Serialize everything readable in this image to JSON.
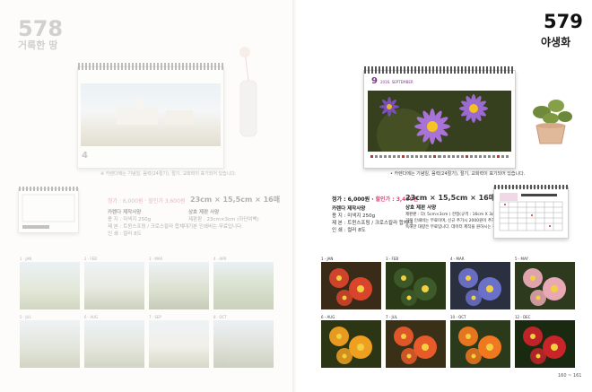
{
  "spread": {
    "page_numbers": "160 ~ 161"
  },
  "left_product": {
    "number": "578",
    "name": "거룩한 땅",
    "caption": "※ 카렌다에는 기념일, 음력(24절기), 절기, 교회력이 표기되어 있습니다.",
    "price_label": "정가 : 6,000원 · 할인가 3,600원",
    "size": "23cm × 15,5cm × 16매",
    "spec_title": "카렌다 제작사양",
    "spec_lines": [
      "용  지 : 미색지 250g",
      "제  본 : 트윈스프링 / 크로스칼라 합체대",
      "인  쇄 : 컬러 8도"
    ],
    "custom_title": "상호 제판 사양",
    "custom_lines": [
      "제판판 : 23cm×3cm (하단여백)",
      "기본 인쇄비는 무료입니다.",
      "..."
    ],
    "months": [
      "1 · JAN",
      "2 · FEB",
      "3 · MAR",
      "4 · APR",
      "5 · JUL",
      "6 · AUG",
      "7 · SEP",
      "8 · OCT"
    ]
  },
  "right_product": {
    "number": "579",
    "name": "야생화",
    "calendar_month": "9",
    "calendar_month_label": "2016. SEPTEMBER",
    "caption": "• 카렌다에는 기념일, 음력(24절기), 절기, 교회력이 표기되어 있습니다.",
    "price_label": "정가 : 6,000원 · ",
    "price_sale": "할인가 : 3,400원",
    "size": "23cm × 15,5cm × 16매",
    "spec_title": "카렌다 제작사양",
    "spec_lines": [
      "용  지 : 미색지 250g",
      "제  본 : 트윈스프링 / 크로스칼라 합체대",
      "인  쇄 : 컬러 8도"
    ],
    "custom_title": "상호 제판 사양",
    "custom_lines": [
      "제판판 : 다( 5cm×3cm ) 한정(규격 : 16cm X 3cm)",
      "기본 인쇄비는 무료이며, 신규 추가시 2000원이 추가됩니다.",
      "독해한 대량은 무료입니다. 데이터 제작을 원하시는 경우 별도"
    ],
    "months": [
      {
        "label": "1 - JAN",
        "color": "#d8452c"
      },
      {
        "label": "3 - FEB",
        "color": "#3d5a2a"
      },
      {
        "label": "4 - MAR",
        "color": "#6b71c8"
      },
      {
        "label": "5 - MAY",
        "color": "#e8a9b4"
      },
      {
        "label": "6 - AUG",
        "color": "#f0a020"
      },
      {
        "label": "7 - JUL",
        "color": "#e85a2a"
      },
      {
        "label": "10 - OCT",
        "color": "#f07820"
      },
      {
        "label": "12 - DEC",
        "color": "#c8242a"
      }
    ]
  }
}
